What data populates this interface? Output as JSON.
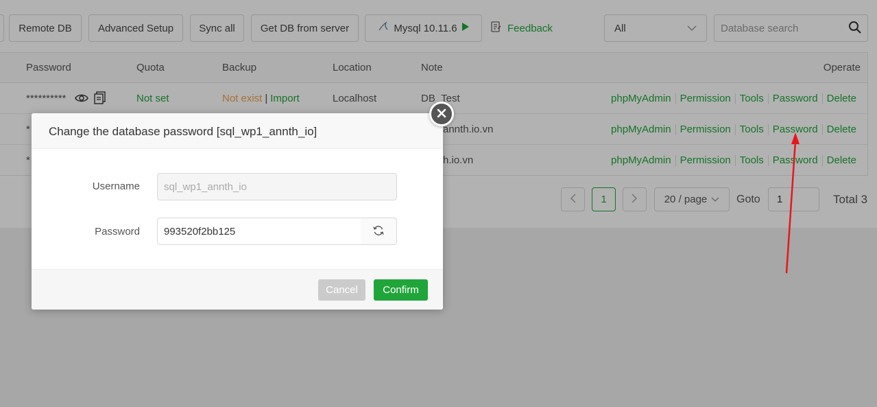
{
  "toolbar": {
    "buttons": [
      "Remote DB",
      "Advanced Setup",
      "Sync all",
      "Get DB from server"
    ],
    "mysql_label": "Mysql 10.11.6",
    "feedback_label": "Feedback",
    "filter_value": "All",
    "search_placeholder": "Database search"
  },
  "table": {
    "headers": {
      "password": "Password",
      "quota": "Quota",
      "backup": "Backup",
      "location": "Location",
      "note": "Note",
      "operate": "Operate"
    },
    "rows": [
      {
        "password_mask": "**********",
        "quota": "Not set",
        "backup_status": "Not exist",
        "backup_separator": "|",
        "backup_action": "Import",
        "location": "Localhost",
        "note": "DB_Test"
      },
      {
        "password_mask": "*",
        "note": "annth.io.vn"
      },
      {
        "password_mask": "*",
        "note": "h.io.vn"
      }
    ],
    "operations": [
      "phpMyAdmin",
      "Permission",
      "Tools",
      "Password",
      "Delete"
    ]
  },
  "pagination": {
    "current_page": "1",
    "page_size": "20 / page",
    "goto_label": "Goto",
    "goto_value": "1",
    "total": "Total 3"
  },
  "modal": {
    "title": "Change the database password [sql_wp1_annth_io]",
    "username_label": "Username",
    "username_value": "sql_wp1_annth_io",
    "password_label": "Password",
    "password_value": "993520f2bb125",
    "cancel_label": "Cancel",
    "confirm_label": "Confirm"
  },
  "colors": {
    "accent": "#20a53a",
    "warning": "#f0a050",
    "annotation_arrow": "#e8161b"
  }
}
